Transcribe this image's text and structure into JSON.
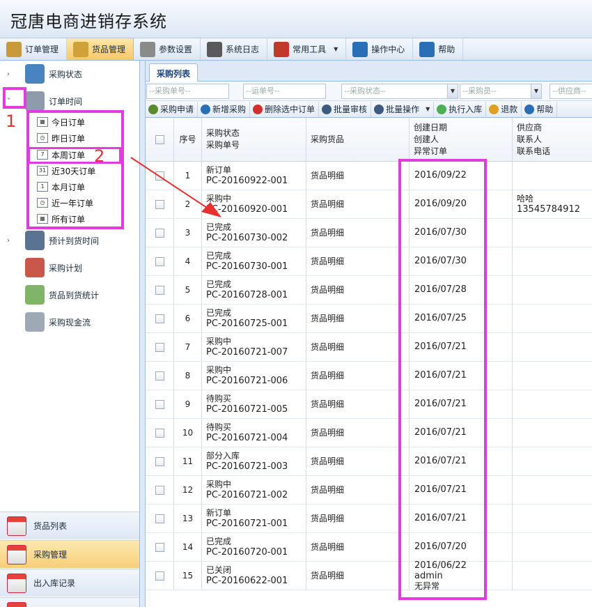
{
  "app": {
    "title": "冠唐电商进销存系统"
  },
  "menu": [
    {
      "label": "订单管理",
      "icon": "clipboard-icon",
      "color": "#c89a3b",
      "active": false
    },
    {
      "label": "货品管理",
      "icon": "goods-box-icon",
      "color": "#d0a23a",
      "active": true
    },
    {
      "label": "参数设置",
      "icon": "gears-icon",
      "color": "#8a8a8a",
      "active": false
    },
    {
      "label": "系统日志",
      "icon": "log-icon",
      "color": "#5a5a5a",
      "active": false
    },
    {
      "label": "常用工具",
      "icon": "toolbox-icon",
      "color": "#c0392b",
      "active": false,
      "dropdown": true
    },
    {
      "label": "操作中心",
      "icon": "control-icon",
      "color": "#2a6fb5",
      "active": false
    },
    {
      "label": "帮助",
      "icon": "help-icon",
      "color": "#2a6fb5",
      "active": false
    }
  ],
  "sidebar": {
    "tree": [
      {
        "label": "采购状态",
        "icon": "history-icon",
        "arrow": "›"
      },
      {
        "label": "订单时间",
        "icon": "calendar-clock-icon",
        "arrow": "˅"
      },
      {
        "label": "预计到货时间",
        "icon": "calendar-7-icon",
        "arrow": "›"
      },
      {
        "label": "采购计划",
        "icon": "calendar-icon",
        "arrow": ""
      },
      {
        "label": "货品到货统计",
        "icon": "flag-icon",
        "arrow": ""
      },
      {
        "label": "采购现金流",
        "icon": "report-icon",
        "arrow": ""
      }
    ],
    "sub_items": [
      {
        "label": "今日订单",
        "glyph": "▦"
      },
      {
        "label": "昨日订单",
        "glyph": "◷"
      },
      {
        "label": "本周订单",
        "glyph": "7"
      },
      {
        "label": "近30天订单",
        "glyph": "31"
      },
      {
        "label": "本月订单",
        "glyph": "1"
      },
      {
        "label": "近一年订单",
        "glyph": "◷"
      },
      {
        "label": "所有订单",
        "glyph": "▦"
      }
    ],
    "bottom_nav": [
      {
        "label": "货品列表",
        "active": false
      },
      {
        "label": "采购管理",
        "active": true
      },
      {
        "label": "出入库记录",
        "active": false
      }
    ]
  },
  "annotations": {
    "label_1": "1",
    "label_2": "2",
    "highlight_color": "#e23be0",
    "arrow_color": "#e8302e"
  },
  "main": {
    "tab": "采购列表",
    "filters": [
      {
        "placeholder": "--采购单号--",
        "dropdown": false
      },
      {
        "placeholder": "--运单号--",
        "dropdown": false
      },
      {
        "placeholder": "--采购状态--",
        "dropdown": true
      },
      {
        "placeholder": "--采购员--",
        "dropdown": true
      },
      {
        "placeholder": "--供应商--",
        "dropdown": false
      }
    ],
    "toolbar": [
      {
        "label": "采购申请",
        "icon": "apply-icon",
        "color": "#5c8a2e",
        "dropdown": false
      },
      {
        "label": "新增采购",
        "icon": "add-icon",
        "color": "#2a6fb5",
        "dropdown": false
      },
      {
        "label": "删除选中订单",
        "icon": "delete-icon",
        "color": "#d32f2f",
        "dropdown": false
      },
      {
        "label": "批量审核",
        "icon": "audit-icon",
        "color": "#3d5a80",
        "dropdown": false
      },
      {
        "label": "批量操作",
        "icon": "batch-icon",
        "color": "#3d5a80",
        "dropdown": true
      },
      {
        "label": "执行入库",
        "icon": "execute-icon",
        "color": "#4caf50",
        "dropdown": false
      },
      {
        "label": "退款",
        "icon": "refund-icon",
        "color": "#e0a020",
        "dropdown": false
      },
      {
        "label": "帮助",
        "icon": "help-icon",
        "color": "#2a6fb5",
        "dropdown": false
      }
    ],
    "columns": {
      "seq": "序号",
      "status_line1": "采购状态",
      "status_line2": "采购单号",
      "goods": "采购货品",
      "date_line1": "创建日期",
      "date_line2": "创建人",
      "date_line3": "异常订单",
      "supplier_line1": "供应商",
      "supplier_line2": "联系人",
      "supplier_line3": "联系电话"
    },
    "rows": [
      {
        "seq": "1",
        "status": "新订单",
        "order_no": "PC-20160922-001",
        "goods": "货品明细",
        "date": "2016/09/22",
        "creator": "",
        "abnormal": "",
        "supplier": "",
        "phone": ""
      },
      {
        "seq": "2",
        "status": "采购中",
        "order_no": "PC-20160920-001",
        "goods": "货品明细",
        "date": "2016/09/20",
        "creator": "",
        "abnormal": "",
        "supplier": "哈哈",
        "phone": "13545784912"
      },
      {
        "seq": "3",
        "status": "已完成",
        "order_no": "PC-20160730-002",
        "goods": "货品明细",
        "date": "2016/07/30",
        "creator": "",
        "abnormal": "",
        "supplier": "",
        "phone": ""
      },
      {
        "seq": "4",
        "status": "已完成",
        "order_no": "PC-20160730-001",
        "goods": "货品明细",
        "date": "2016/07/30",
        "creator": "",
        "abnormal": "",
        "supplier": "",
        "phone": ""
      },
      {
        "seq": "5",
        "status": "已完成",
        "order_no": "PC-20160728-001",
        "goods": "货品明细",
        "date": "2016/07/28",
        "creator": "",
        "abnormal": "",
        "supplier": "",
        "phone": ""
      },
      {
        "seq": "6",
        "status": "已完成",
        "order_no": "PC-20160725-001",
        "goods": "货品明细",
        "date": "2016/07/25",
        "creator": "",
        "abnormal": "",
        "supplier": "",
        "phone": ""
      },
      {
        "seq": "7",
        "status": "采购中",
        "order_no": "PC-20160721-007",
        "goods": "货品明细",
        "date": "2016/07/21",
        "creator": "",
        "abnormal": "",
        "supplier": "",
        "phone": ""
      },
      {
        "seq": "8",
        "status": "采购中",
        "order_no": "PC-20160721-006",
        "goods": "货品明细",
        "date": "2016/07/21",
        "creator": "",
        "abnormal": "",
        "supplier": "",
        "phone": ""
      },
      {
        "seq": "9",
        "status": "待购买",
        "order_no": "PC-20160721-005",
        "goods": "货品明细",
        "date": "2016/07/21",
        "creator": "",
        "abnormal": "",
        "supplier": "",
        "phone": ""
      },
      {
        "seq": "10",
        "status": "待购买",
        "order_no": "PC-20160721-004",
        "goods": "货品明细",
        "date": "2016/07/21",
        "creator": "",
        "abnormal": "",
        "supplier": "",
        "phone": ""
      },
      {
        "seq": "11",
        "status": "部分入库",
        "order_no": "PC-20160721-003",
        "goods": "货品明细",
        "date": "2016/07/21",
        "creator": "",
        "abnormal": "",
        "supplier": "",
        "phone": ""
      },
      {
        "seq": "12",
        "status": "采购中",
        "order_no": "PC-20160721-002",
        "goods": "货品明细",
        "date": "2016/07/21",
        "creator": "",
        "abnormal": "",
        "supplier": "",
        "phone": ""
      },
      {
        "seq": "13",
        "status": "新订单",
        "order_no": "PC-20160721-001",
        "goods": "货品明细",
        "date": "2016/07/21",
        "creator": "",
        "abnormal": "",
        "supplier": "",
        "phone": ""
      },
      {
        "seq": "14",
        "status": "已完成",
        "order_no": "PC-20160720-001",
        "goods": "货品明细",
        "date": "2016/07/20",
        "creator": "",
        "abnormal": "",
        "supplier": "",
        "phone": ""
      },
      {
        "seq": "15",
        "status": "已关闭",
        "order_no": "PC-20160622-001",
        "goods": "货品明细",
        "date": "2016/06/22",
        "creator": "admin",
        "abnormal": "无异常",
        "supplier": "",
        "phone": ""
      }
    ]
  }
}
